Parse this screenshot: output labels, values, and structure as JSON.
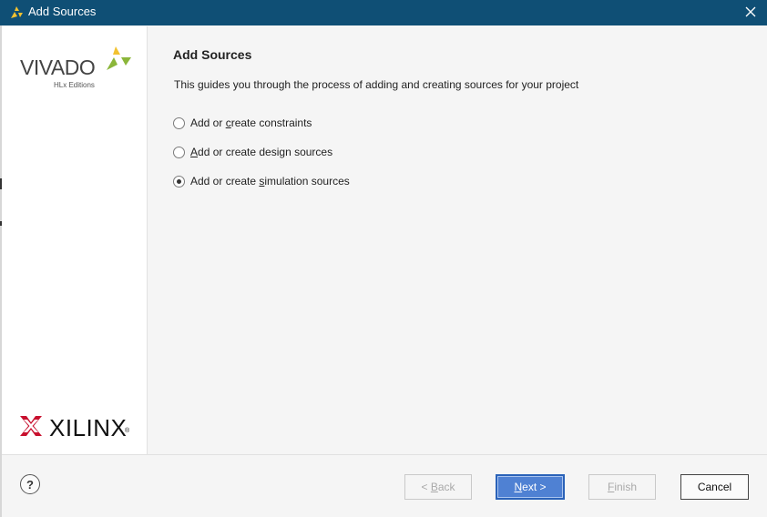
{
  "window": {
    "title": "Add Sources",
    "app_icon": "vivado-icon",
    "close_icon": "close-icon"
  },
  "sidebar": {
    "vivado_logo": {
      "name": "VIVADO",
      "edition": "HLx Editions"
    },
    "xilinx_logo": {
      "name": "XILINX",
      "registered": "®"
    }
  },
  "main": {
    "heading": "Add Sources",
    "description": "This guides you through the process of adding and creating sources for your project",
    "options": [
      {
        "pre": "Add or ",
        "mnemonic": "c",
        "post": "reate constraints",
        "checked": false
      },
      {
        "pre": "",
        "mnemonic": "A",
        "post": "dd or create design sources",
        "checked": false
      },
      {
        "pre": "Add or create ",
        "mnemonic": "s",
        "post": "imulation sources",
        "checked": true
      }
    ]
  },
  "footer": {
    "help_label": "?",
    "back": {
      "pre": "< ",
      "mnemonic": "B",
      "post": "ack",
      "enabled": false
    },
    "next": {
      "pre": "",
      "mnemonic": "N",
      "post": "ext >",
      "enabled": true
    },
    "finish": {
      "pre": "",
      "mnemonic": "F",
      "post": "inish",
      "enabled": false
    },
    "cancel": {
      "label": "Cancel",
      "enabled": true
    }
  },
  "colors": {
    "titlebar": "#0f4f75",
    "primary_button": "#4f81d3",
    "xilinx_red": "#c8102e",
    "vivado_green": "#8bb63a"
  }
}
